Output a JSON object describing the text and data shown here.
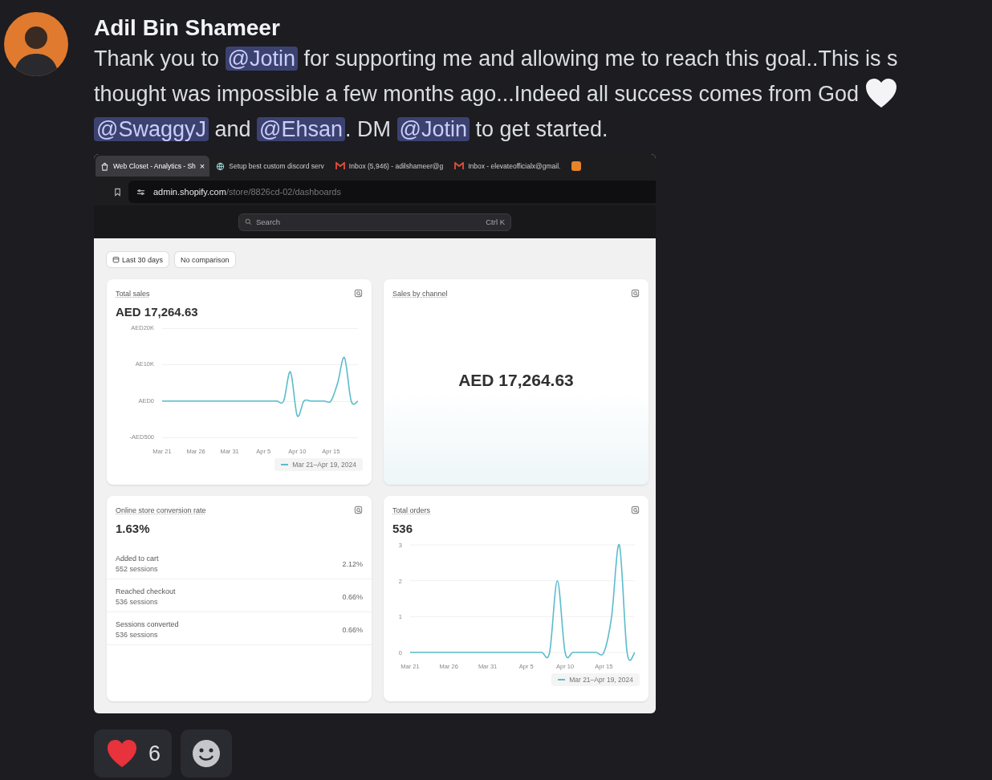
{
  "author": {
    "name": "Adil Bin Shameer"
  },
  "message": {
    "lines": [
      [
        {
          "kind": "text",
          "text": "Thank you to "
        },
        {
          "kind": "mention",
          "text": "@Jotin"
        },
        {
          "kind": "text",
          "text": " for supporting me and allowing me to reach this goal..This is s"
        }
      ],
      [
        {
          "kind": "text",
          "text": "thought was impossible a few months ago...Indeed all success comes from God "
        },
        {
          "kind": "emoji"
        }
      ],
      [
        {
          "kind": "mention",
          "text": "@SwaggyJ"
        },
        {
          "kind": "text",
          "text": " and "
        },
        {
          "kind": "mention",
          "text": "@Ehsan"
        },
        {
          "kind": "text",
          "text": ". DM "
        },
        {
          "kind": "mention",
          "text": "@Jotin"
        },
        {
          "kind": "text",
          "text": " to get started."
        }
      ]
    ]
  },
  "screenshot": {
    "tabs": [
      {
        "title": "Web Closet - Analytics - Sh",
        "kind": "store",
        "close": "×",
        "selected": true
      },
      {
        "title": "Setup best custom discord serv",
        "kind": "site",
        "selected": false
      },
      {
        "title": "Inbox (5,946) - adilshameer@g",
        "kind": "mail",
        "selected": false
      },
      {
        "title": "Inbox - elevateofficialx@gmail.",
        "kind": "mail",
        "selected": false
      },
      {
        "kind": "app",
        "selected": false
      }
    ],
    "address": {
      "host": "admin.shopify.com",
      "path": "/store/8826cd-02/dashboards"
    },
    "search": {
      "placeholder": "Search",
      "shortcut": "Ctrl K"
    },
    "filters": [
      {
        "label": "Last 30 days",
        "kind": "date"
      },
      {
        "label": "No comparison",
        "kind": "plain"
      }
    ],
    "cards": [
      {
        "kind": "sparkline",
        "title": "Total sales",
        "value": "AED 17,264.63",
        "axis_labels": [
          "AED20K",
          "AE10K",
          "AED0",
          "-AED500"
        ],
        "x_labels": [
          "Mar 21",
          "Mar 26",
          "Mar 31",
          "Apr 5",
          "Apr 10",
          "Apr 15"
        ],
        "legend": "Mar 21–Apr 19, 2024"
      },
      {
        "kind": "number",
        "title": "Sales by channel",
        "value": "AED 17,264.63"
      },
      {
        "kind": "funnel",
        "title": "Online store conversion rate",
        "value": "1.63%",
        "rows": [
          {
            "label": "Added to cart",
            "sessions": "552 sessions",
            "rate": "2.12%"
          },
          {
            "label": "Reached checkout",
            "sessions": "536 sessions",
            "rate": "0.66%"
          },
          {
            "label": "Sessions converted",
            "sessions": "536 sessions",
            "rate": "0.66%"
          }
        ]
      },
      {
        "kind": "line",
        "title": "Total orders",
        "value": "536",
        "chart_data": {
          "type": "line",
          "categories": [
            "Mar 21",
            null,
            null,
            null,
            null,
            "Mar 26",
            null,
            null,
            null,
            null,
            "Mar 31",
            null,
            null,
            null,
            null,
            "Apr 5",
            null,
            null,
            null,
            null,
            "Apr 10",
            null,
            null,
            null,
            null,
            "Apr 15",
            null,
            null,
            null,
            null
          ],
          "series": [
            {
              "name": "Mar 21–Apr 19, 2024",
              "color": "#5bbccb",
              "values": [
                0,
                0,
                0,
                0,
                0,
                0,
                0,
                0,
                0,
                0,
                0,
                0,
                0,
                0,
                0,
                0,
                0,
                0,
                0,
                2,
                0,
                0,
                0,
                0,
                0,
                0,
                1,
                3,
                0,
                0
              ]
            }
          ],
          "ylim": [
            0,
            3
          ],
          "yticks": [
            3,
            2,
            1,
            0
          ]
        }
      }
    ]
  },
  "reactions": [
    {
      "kind": "heart",
      "count": "6"
    }
  ]
}
